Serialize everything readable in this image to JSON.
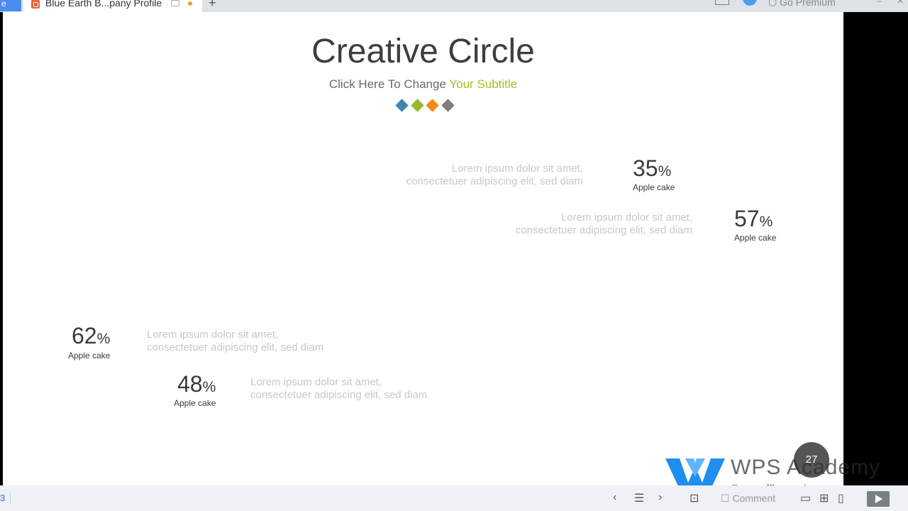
{
  "tabbar": {
    "left_tab_label": "e",
    "active_tab_title": "Blue Earth B...pany Profile",
    "new_tab_label": "+",
    "premium_label": "Go Premium",
    "minimize_label": "–",
    "close_label": "✕"
  },
  "slide": {
    "title": "Creative Circle",
    "subtitle_prefix": "Click Here To Change ",
    "subtitle_highlight": "Your Subtitle",
    "diamond_colors": [
      "#3f86b8",
      "#9ab82a",
      "#f28c12",
      "#7e7e7e"
    ],
    "stats": [
      {
        "value": "35",
        "unit": "%",
        "label": "Apple cake",
        "desc_line1": "Lorem ipsum dolor sit amet,",
        "desc_line2": "consectetuer adipiscing elit, sed diam"
      },
      {
        "value": "57",
        "unit": "%",
        "label": "Apple cake",
        "desc_line1": "Lorem ipsum dolor sit amet,",
        "desc_line2": "consectetuer adipiscing elit, sed diam"
      },
      {
        "value": "62",
        "unit": "%",
        "label": "Apple cake",
        "desc_line1": "Lorem ipsum dolor sit amet,",
        "desc_line2": "consectetuer adipiscing elit, sed diam"
      },
      {
        "value": "48",
        "unit": "%",
        "label": "Apple cake",
        "desc_line1": "Lorem ipsum dolor sit amet,",
        "desc_line2": "consectetuer adipiscing elit, sed diam"
      }
    ],
    "page_number": "27"
  },
  "watermark": {
    "title": "WPS Academy",
    "subtitle": "Free office suite tutorials"
  },
  "statusbar": {
    "page_indicator": "3",
    "comment_label": "Comment"
  },
  "colors": {
    "accent_blue": "#4a8cf0",
    "subtitle_highlight": "#a8be2a",
    "wps_logo": "#1f8ef0"
  }
}
